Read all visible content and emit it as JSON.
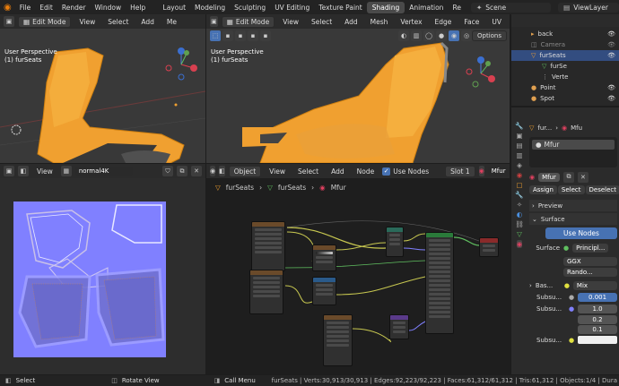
{
  "topbar": {
    "menus": [
      "File",
      "Edit",
      "Render",
      "Window",
      "Help"
    ],
    "workspaces": [
      "Layout",
      "Modeling",
      "Sculpting",
      "UV Editing",
      "Texture Paint",
      "Shading",
      "Animation",
      "Re"
    ],
    "active_workspace": "Shading",
    "scene": "Scene",
    "view_layer": "ViewLayer"
  },
  "left_viewport": {
    "mode": "Edit Mode",
    "menus": [
      "View",
      "Select",
      "Add",
      "Me"
    ],
    "perspective": "User Perspective",
    "object": "(1) furSeats"
  },
  "center_viewport": {
    "mode": "Edit Mode",
    "menus": [
      "View",
      "Select",
      "Add",
      "Mesh",
      "Vertex",
      "Edge",
      "Face",
      "UV"
    ],
    "options": "Options",
    "perspective": "User Perspective",
    "object": "(1) furSeats"
  },
  "image_editor": {
    "view": "View",
    "image_name": "normal4K"
  },
  "node_editor": {
    "object_type": "Object",
    "menus": [
      "View",
      "Select",
      "Add",
      "Node"
    ],
    "use_nodes": "Use Nodes",
    "slot": "Slot 1",
    "material": "Mfur",
    "breadcrumb": [
      "furSeats",
      "furSeats",
      "Mfur"
    ]
  },
  "outliner": {
    "items": [
      {
        "label": "back",
        "indent": 1,
        "icon": "collection",
        "selected": false,
        "dim": false
      },
      {
        "label": "Camera",
        "indent": 1,
        "icon": "camera",
        "selected": false,
        "dim": true
      },
      {
        "label": "furSeats",
        "indent": 1,
        "icon": "mesh",
        "selected": true,
        "dim": false
      },
      {
        "label": "furSe",
        "indent": 2,
        "icon": "mesh-data",
        "selected": false,
        "dim": false
      },
      {
        "label": "Verte",
        "indent": 2,
        "icon": "vertex-group",
        "selected": false,
        "dim": false
      },
      {
        "label": "Point",
        "indent": 1,
        "icon": "light",
        "selected": false,
        "dim": false
      },
      {
        "label": "Spot",
        "indent": 1,
        "icon": "light",
        "selected": false,
        "dim": false
      }
    ]
  },
  "properties": {
    "object_name": "fur...",
    "material_header": "Mfu",
    "material_slot": "Mfur",
    "material_field": "Mfur",
    "assign": "Assign",
    "select": "Select",
    "deselect": "Deselect",
    "preview": "Preview",
    "surface_section": "Surface",
    "use_nodes": "Use Nodes",
    "surface_label": "Surface",
    "surface_value": "Principl...",
    "distribution": "GGX",
    "subsurface_method": "Rando...",
    "base_color_label": "Bas...",
    "base_color_value": "Mix",
    "subsurface_label": "Subsu...",
    "subsurface_value": "0.001",
    "subsurface_radius_label": "Subsu...",
    "radius_values": [
      "1.0",
      "0.2",
      "0.1"
    ],
    "subsurface_color_label": "Subsu..."
  },
  "statusbar": {
    "select": "Select",
    "rotate": "Rotate View",
    "menu": "Call Menu",
    "stats": "furSeats | Verts:30,913/30,913 | Edges:92,223/92,223 | Faces:61,312/61,312 | Tris:61,312 | Objects:1/4 | Dura"
  },
  "colors": {
    "accent": "#4772b3",
    "fur": "#f0a030",
    "uv_bg": "#8080ff",
    "node_bg": "#1e1e1e"
  }
}
